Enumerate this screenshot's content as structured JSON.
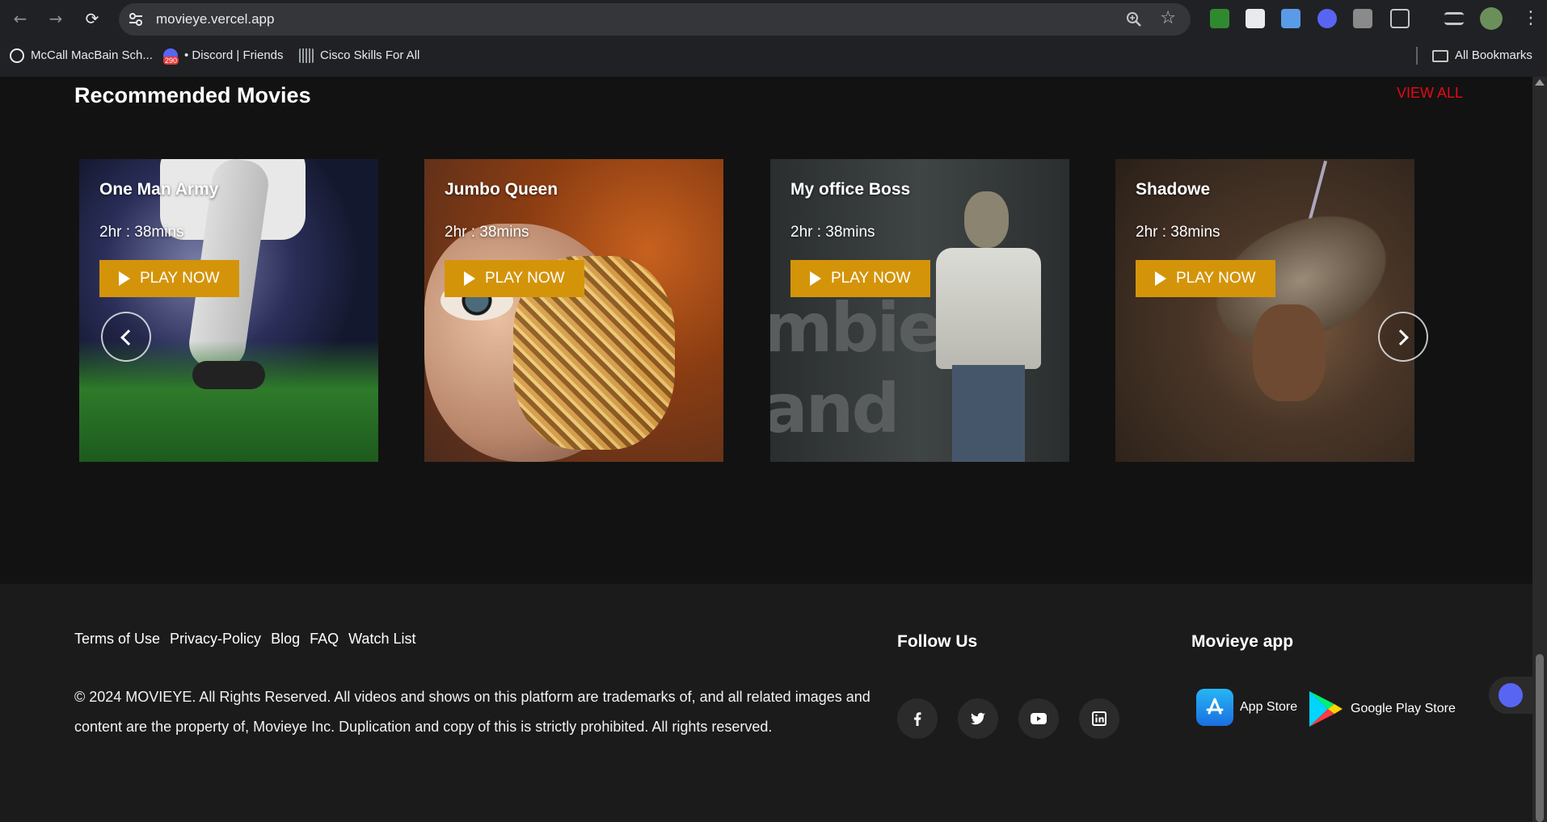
{
  "browser": {
    "url": "movieye.vercel.app",
    "bookmarks": [
      {
        "label": "McCall MacBain Sch..."
      },
      {
        "label": "• Discord | Friends",
        "badge": "290"
      },
      {
        "label": "Cisco Skills For All"
      }
    ],
    "all_bookmarks_label": "All Bookmarks"
  },
  "section": {
    "title": "Recommended Movies",
    "view_all_label": "VIEW ALL"
  },
  "movies": [
    {
      "title": "One Man Army",
      "duration": "2hr : 38mins",
      "play_label": "PLAY NOW"
    },
    {
      "title": "Jumbo Queen",
      "duration": "2hr : 38mins",
      "play_label": "PLAY NOW"
    },
    {
      "title": "My office Boss",
      "duration": "2hr : 38mins",
      "play_label": "PLAY NOW",
      "poster_words": [
        "mbie",
        "and"
      ]
    },
    {
      "title": "Shadowe",
      "duration": "2hr : 38mins",
      "play_label": "PLAY NOW"
    }
  ],
  "footer": {
    "links": [
      "Terms of Use",
      "Privacy-Policy",
      "Blog",
      "FAQ",
      "Watch List"
    ],
    "copyright": "© 2024 MOVIEYE. All Rights Reserved. All videos and shows on this platform are trademarks of, and all related images and content are the property of, Movieye Inc. Duplication and copy of this is strictly prohibited. All rights reserved.",
    "follow_title": "Follow Us",
    "socials": [
      "facebook-icon",
      "twitter-icon",
      "youtube-icon",
      "linkedin-icon"
    ],
    "app_title": "Movieye app",
    "app_store_label": "App Store",
    "play_store_label": "Google Play Store"
  },
  "colors": {
    "accent": "#d4940a",
    "view_all": "#e50914",
    "background": "#121212",
    "footer_bg": "#1b1b1b"
  }
}
